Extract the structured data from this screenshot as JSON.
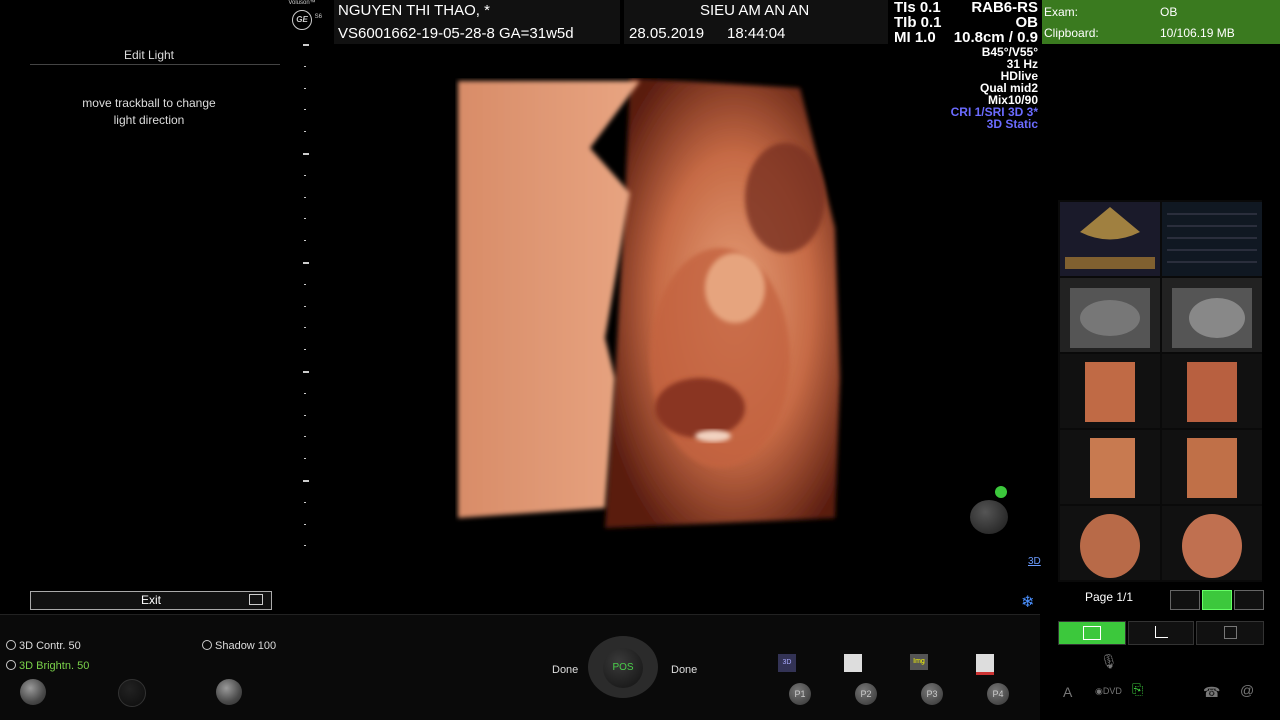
{
  "logo": {
    "brand": "Voluson™",
    "model": "S6",
    "ge": "GE"
  },
  "header": {
    "patient": "NGUYEN THI THAO,   *",
    "clinic": "SIEU AM AN AN",
    "id_line": "VS6001662-19-05-28-8  GA=31w5d",
    "date": "28.05.2019",
    "time": "18:44:04",
    "tis": "TIs  0.1",
    "tib": "TIb  0.1",
    "mi": "MI  1.0",
    "probe": "RAB6-RS",
    "preset": "OB",
    "depth": "10.8cm / 0.9"
  },
  "params": [
    "B45°/V55°",
    "31 Hz",
    "HDlive",
    "Qual mid2",
    "Mix10/90"
  ],
  "params_blue": [
    "CRI 1/SRI 3D 3*",
    "3D Static"
  ],
  "exam": {
    "exam_label": "Exam:",
    "exam_value": "OB",
    "clip_label": "Clipboard:",
    "clip_value": "10/106.19 MB"
  },
  "left_panel": {
    "title": "Edit Light",
    "msg1": "move trackball to change",
    "msg2": "light direction",
    "exit": "Exit"
  },
  "controls": {
    "contr": "3D Contr. 50",
    "bright": "3D Brightn. 50",
    "shadow": "Shadow 100",
    "done_left": "Done",
    "done_right": "Done",
    "pos": "POS",
    "p1": "P1",
    "p2": "P2",
    "p3": "P3",
    "p4": "P4",
    "img_icon_label": "Img",
    "icon_3d_label": "3D"
  },
  "right_panel": {
    "page": "Page 1/1",
    "dvd": "DVD",
    "mode_3d": "3D"
  }
}
